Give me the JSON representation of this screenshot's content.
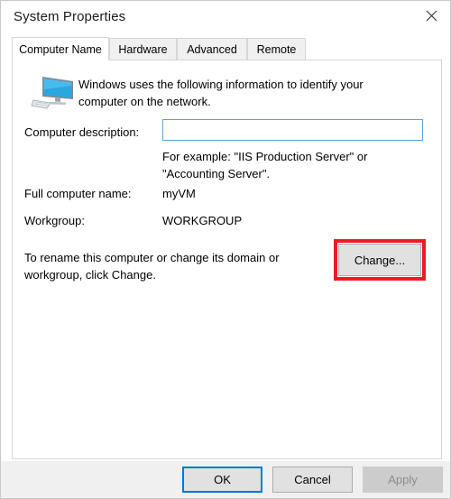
{
  "window": {
    "title": "System Properties",
    "close_icon": "close-x-icon"
  },
  "tabs": [
    {
      "label": "Computer Name",
      "active": true
    },
    {
      "label": "Hardware",
      "active": false
    },
    {
      "label": "Advanced",
      "active": false
    },
    {
      "label": "Remote",
      "active": false
    }
  ],
  "panel": {
    "icon": "computer-monitor-icon",
    "intro_text": "Windows uses the following information to identify your computer on the network.",
    "description": {
      "label": "Computer description:",
      "value": "",
      "placeholder": "",
      "example_text": "For example: \"IIS Production Server\" or \"Accounting Server\"."
    },
    "full_computer_name": {
      "label": "Full computer name:",
      "value": "myVM"
    },
    "workgroup": {
      "label": "Workgroup:",
      "value": "WORKGROUP"
    },
    "rename": {
      "text": "To rename this computer or change its domain or workgroup, click Change.",
      "button_label": "Change..."
    }
  },
  "footer": {
    "ok_label": "OK",
    "cancel_label": "Cancel",
    "apply_label": "Apply"
  },
  "colors": {
    "highlight_red": "#ec1c24",
    "focus_blue": "#0078d7",
    "input_border_blue": "#5ba3dc",
    "button_face": "#e1e1e1",
    "disabled_text": "#8c8c8c"
  }
}
